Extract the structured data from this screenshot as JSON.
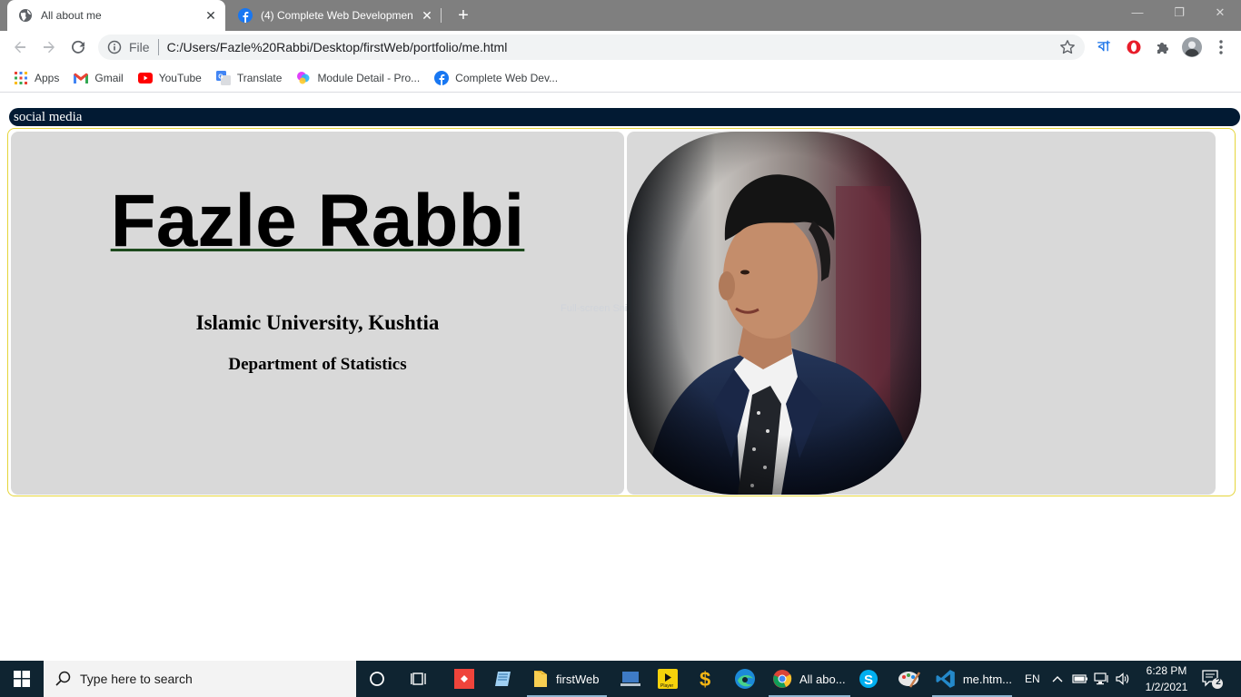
{
  "browser": {
    "tabs": [
      {
        "title": "All about me",
        "active": true,
        "favicon": "globe-icon"
      },
      {
        "title": "(4) Complete Web Developmen",
        "active": false,
        "favicon": "facebook-icon"
      }
    ],
    "new_tab": "+",
    "window_controls": {
      "minimize": "—",
      "restore": "❐",
      "close": "✕"
    },
    "address": {
      "scheme": "File",
      "url": "C:/Users/Fazle%20Rabbi/Desktop/firstWeb/portfolio/me.html"
    },
    "extension_text": "বা"
  },
  "bookmarks": [
    {
      "label": "Apps",
      "icon": "apps-grid-icon"
    },
    {
      "label": "Gmail",
      "icon": "gmail-icon"
    },
    {
      "label": "YouTube",
      "icon": "youtube-icon"
    },
    {
      "label": "Translate",
      "icon": "translate-icon"
    },
    {
      "label": "Module Detail - Pro...",
      "icon": "module-icon"
    },
    {
      "label": "Complete Web Dev...",
      "icon": "facebook-icon"
    }
  ],
  "page": {
    "social_bar": "social media",
    "name": "Fazle Rabbi",
    "university": "Islamic University, Kushtia",
    "department": "Department of Statistics",
    "ghost_text": "Full-screen Snip"
  },
  "taskbar": {
    "search_placeholder": "Type here to search",
    "apps": [
      {
        "label": "firstWeb",
        "icon": "folder-icon"
      },
      {
        "label": "All abo...",
        "icon": "chrome-icon"
      },
      {
        "label": "me.htm...",
        "icon": "vscode-icon"
      }
    ],
    "language": "EN",
    "time": "6:28 PM",
    "date": "1/2/2021",
    "notifications": "2"
  },
  "colors": {
    "tabstrip": "#7f7f7f",
    "social_bar": "#021a33",
    "panel": "#d9d9d9",
    "frame_border": "#e5d53a",
    "taskbar": "#0f2431"
  }
}
